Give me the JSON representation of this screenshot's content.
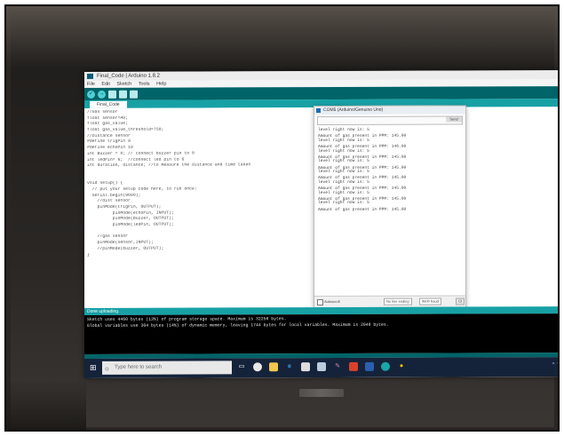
{
  "window": {
    "title": "Final_Code | Arduino 1.8.2",
    "menu": [
      "File",
      "Edit",
      "Sketch",
      "Tools",
      "Help"
    ],
    "toolbar_icons": [
      "verify-icon",
      "upload-icon",
      "new-icon",
      "open-icon",
      "save-icon"
    ],
    "tab_label": "Final_Code"
  },
  "editor": {
    "lines": [
      "//Gas sensor",
      "float sensor=A0;",
      "float gas_value;",
      "float gas_value_threshold=750;",
      "//Distance sensor",
      "#define trigPin 9",
      "#define echoPin 10",
      "int Buzzer = 8; // connect buzzer pin to 8",
      "int ledPin= 6;  //connect led pin to 6",
      "int duration, distance; //to measure the distance and time taken",
      "",
      "",
      "void setup() {",
      "  // put your setup code here, to run once:",
      "  Serial.begin(9600);",
      "    //dist sensor",
      "    pinMode(trigPin, OUTPUT);",
      "          pinMode(echoPin, INPUT);",
      "          pinMode(Buzzer, OUTPUT);",
      "          pinMode(ledPin, OUTPUT);",
      "",
      "    //gas sensor",
      "    pinMode(sensor,INPUT);",
      "    //pinMode(buzzer, OUTPUT);",
      "}"
    ]
  },
  "serial_monitor": {
    "title": "COM5 (Arduino/Genuino Uno)",
    "send_label": "Send",
    "output": [
      "level right now is: 5",
      "",
      "Amount of gas present in PPM: 145.00",
      "level right now is: 5",
      "",
      "Amount of gas present in PPM: 146.00",
      "level right now is: 5",
      "",
      "Amount of gas present in PPM: 145.00",
      "level right now is: 5",
      "",
      "Amount of gas present in PPM: 145.00",
      "level right now is: 5",
      "",
      "Amount of gas present in PPM: 145.00",
      "level right now is: 5",
      "",
      "Amount of gas present in PPM: 145.00",
      "level right now is: 5",
      "",
      "Amount of gas present in PPM: 145.00",
      "level right now is: 5",
      "",
      "Amount of gas present in PPM: 145.00"
    ],
    "autoscroll_label": "Autoscroll",
    "line_ending": "No line ending",
    "baud": "9600 baud",
    "clear_label": "Cl"
  },
  "status": {
    "text": "Done uploading."
  },
  "console": {
    "lines": [
      "Sketch uses 4460 bytes (13%) of program storage space. Maximum is 32256 bytes.",
      "Global variables use 304 bytes (14%) of dynamic memory, leaving 1744 bytes for local variables. Maximum is 2048 bytes."
    ]
  },
  "taskbar": {
    "search_placeholder": "Type here to search",
    "icons": [
      "task-view-icon",
      "chrome-icon",
      "file-explorer-icon",
      "edge-icon",
      "store-icon",
      "photos-icon",
      "paint-icon",
      "office-icon",
      "word-icon",
      "arduino-icon",
      "maps-icon"
    ]
  }
}
